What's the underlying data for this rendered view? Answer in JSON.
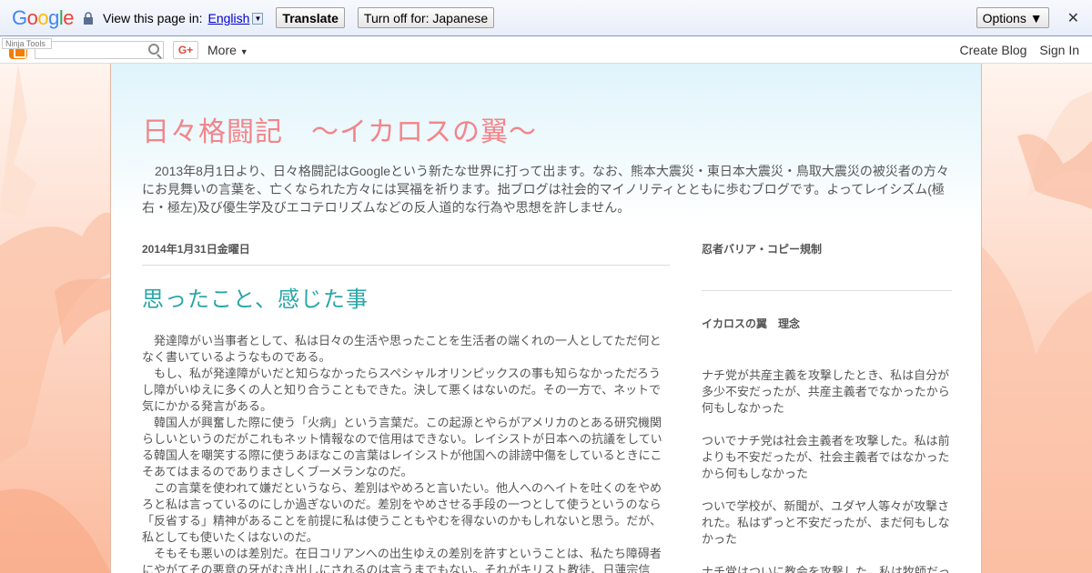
{
  "translate_bar": {
    "logo_letters": [
      "G",
      "o",
      "o",
      "g",
      "l",
      "e"
    ],
    "view_text": "View this page in:",
    "language": "English",
    "translate_button": "Translate",
    "turn_off_button": "Turn off for: Japanese",
    "options_button": "Options ▼",
    "close_symbol": "✕"
  },
  "navbar": {
    "ninja_label": "Ninja Tools",
    "gplus_label": "G+",
    "more_label": "More",
    "create_blog": "Create Blog",
    "sign_in": "Sign In"
  },
  "blog": {
    "title": "日々格闘記　～イカロスの翼～",
    "description": "　2013年8月1日より、日々格闘記はGoogleという新たな世界に打って出ます。なお、熊本大震災・東日本大震災・鳥取大震災の被災者の方々にお見舞いの言葉を、亡くなられた方々には冥福を祈ります。拙ブログは社会的マイノリティとともに歩むブログです。よってレイシズム(極右・極左)及び優生学及びエコテロリズムなどの反人道的な行為や思想を許しません。"
  },
  "post": {
    "date": "2014年1月31日金曜日",
    "title": "思ったこと、感じた事",
    "paragraphs": [
      "発達障がい当事者として、私は日々の生活や思ったことを生活者の端くれの一人としてただ何となく書いているようなものである。",
      "もし、私が発達障がいだと知らなかったらスペシャルオリンピックスの事も知らなかっただろうし障がいゆえに多くの人と知り合うこともできた。決して悪くはないのだ。その一方で、ネットで気にかかる発言がある。",
      "韓国人が興奮した際に使う「火病」という言葉だ。この起源とやらがアメリカのとある研究機関らしいというのだがこれもネット情報なので信用はできない。レイシストが日本への抗議をしている韓国人を嘲笑する際に使うあほなこの言葉はレイシストが他国への誹謗中傷をしているときにこそあてはまるのでありまさしくブーメランなのだ。",
      "この言葉を使われて嫌だというなら、差別はやめろと言いたい。他人へのヘイトを吐くのをやめろと私は言っているのにしか過ぎないのだ。差別をやめさせる手段の一つとして使うというのなら「反省する」精神があることを前提に私は使うこともやむを得ないのかもしれないと思う。だが、私としても使いたくはないのだ。",
      "そもそも悪いのは差別だ。在日コリアンへの出生ゆえの差別を許すということは、私たち障碍者にやがてその悪意の牙がむき出しにされるのは言うまでもない。それがキリスト教徒、日蓮宗信"
    ]
  },
  "sidebar": {
    "widget1_title": "忍者バリア・コピー規制",
    "widget2_title": "イカロスの翼　理念",
    "widget2_paragraphs": [
      "ナチ党が共産主義を攻撃したとき、私は自分が多少不安だったが、共産主義者でなかったから何もしなかった",
      "ついでナチ党は社会主義者を攻撃した。私は前よりも不安だったが、社会主義者ではなかったから何もしなかった",
      "ついで学校が、新聞が、ユダヤ人等々が攻撃された。私はずっと不安だったが、まだ何もしなかった",
      "ナチ党はついに教会を攻撃した。私は牧師だっ"
    ]
  }
}
